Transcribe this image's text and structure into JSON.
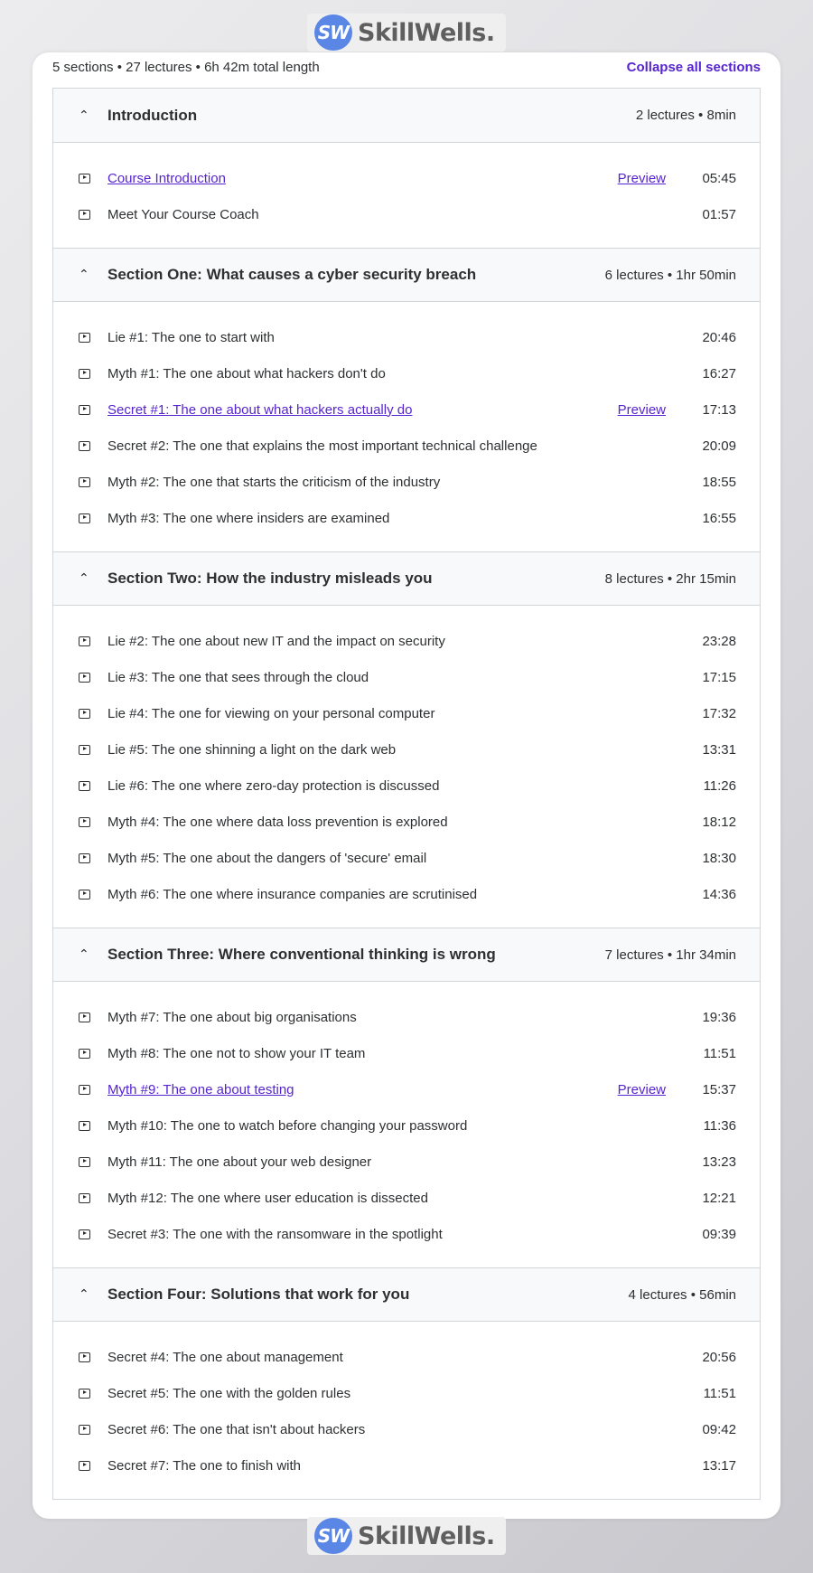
{
  "watermark": {
    "mark": "SW",
    "text": "SkillWells."
  },
  "summary": "5 sections • 27 lectures • 6h 42m total length",
  "collapse_label": "Collapse all sections",
  "icons": {
    "section_toggle": "chevron-up-icon",
    "lecture": "play-video-icon"
  },
  "colors": {
    "link": "#5624d0",
    "header_bg": "#f7f9fa",
    "border": "#d1d7dc",
    "logo": "#5a86e6"
  },
  "sections": [
    {
      "title": "Introduction",
      "meta": "2 lectures • 8min",
      "lectures": [
        {
          "title": "Course Introduction",
          "duration": "05:45",
          "preview": "Preview"
        },
        {
          "title": "Meet Your Course Coach",
          "duration": "01:57"
        }
      ]
    },
    {
      "title": "Section One: What causes a cyber security breach",
      "meta": "6 lectures • 1hr 50min",
      "lectures": [
        {
          "title": "Lie #1: The one to start with",
          "duration": "20:46"
        },
        {
          "title": "Myth #1: The one about what hackers don't do",
          "duration": "16:27"
        },
        {
          "title": "Secret #1: The one about what hackers actually do",
          "duration": "17:13",
          "preview": "Preview"
        },
        {
          "title": "Secret #2: The one that explains the most important technical challenge",
          "duration": "20:09"
        },
        {
          "title": "Myth #2: The one that starts the criticism of the industry",
          "duration": "18:55"
        },
        {
          "title": "Myth #3: The one where insiders are examined",
          "duration": "16:55"
        }
      ]
    },
    {
      "title": "Section Two: How the industry misleads you",
      "meta": "8 lectures • 2hr 15min",
      "lectures": [
        {
          "title": "Lie #2: The one about new IT and the impact on security",
          "duration": "23:28"
        },
        {
          "title": "Lie #3: The one that sees through the cloud",
          "duration": "17:15"
        },
        {
          "title": "Lie #4: The one for viewing on your personal computer",
          "duration": "17:32"
        },
        {
          "title": "Lie #5: The one shinning a light on the dark web",
          "duration": "13:31"
        },
        {
          "title": "Lie #6: The one where zero-day protection is discussed",
          "duration": "11:26"
        },
        {
          "title": "Myth #4: The one where data loss prevention is explored",
          "duration": "18:12"
        },
        {
          "title": "Myth #5: The one about the dangers of 'secure' email",
          "duration": "18:30"
        },
        {
          "title": "Myth #6: The one where insurance companies are scrutinised",
          "duration": "14:36"
        }
      ]
    },
    {
      "title": "Section Three: Where conventional thinking is wrong",
      "meta": "7 lectures • 1hr 34min",
      "lectures": [
        {
          "title": "Myth #7: The one about big organisations",
          "duration": "19:36"
        },
        {
          "title": "Myth #8: The one not to show your IT team",
          "duration": "11:51"
        },
        {
          "title": "Myth #9: The one about testing",
          "duration": "15:37",
          "preview": "Preview"
        },
        {
          "title": "Myth #10: The one to watch before changing your password",
          "duration": "11:36"
        },
        {
          "title": "Myth #11: The one about your web designer",
          "duration": "13:23"
        },
        {
          "title": "Myth #12: The one where user education is dissected",
          "duration": "12:21"
        },
        {
          "title": "Secret #3: The one with the ransomware in the spotlight",
          "duration": "09:39"
        }
      ]
    },
    {
      "title": "Section Four: Solutions that work for you",
      "meta": "4 lectures • 56min",
      "lectures": [
        {
          "title": "Secret #4: The one about management",
          "duration": "20:56"
        },
        {
          "title": "Secret #5: The one with the golden rules",
          "duration": "11:51"
        },
        {
          "title": "Secret #6: The one that isn't about hackers",
          "duration": "09:42"
        },
        {
          "title": "Secret #7: The one to finish with",
          "duration": "13:17"
        }
      ]
    }
  ]
}
